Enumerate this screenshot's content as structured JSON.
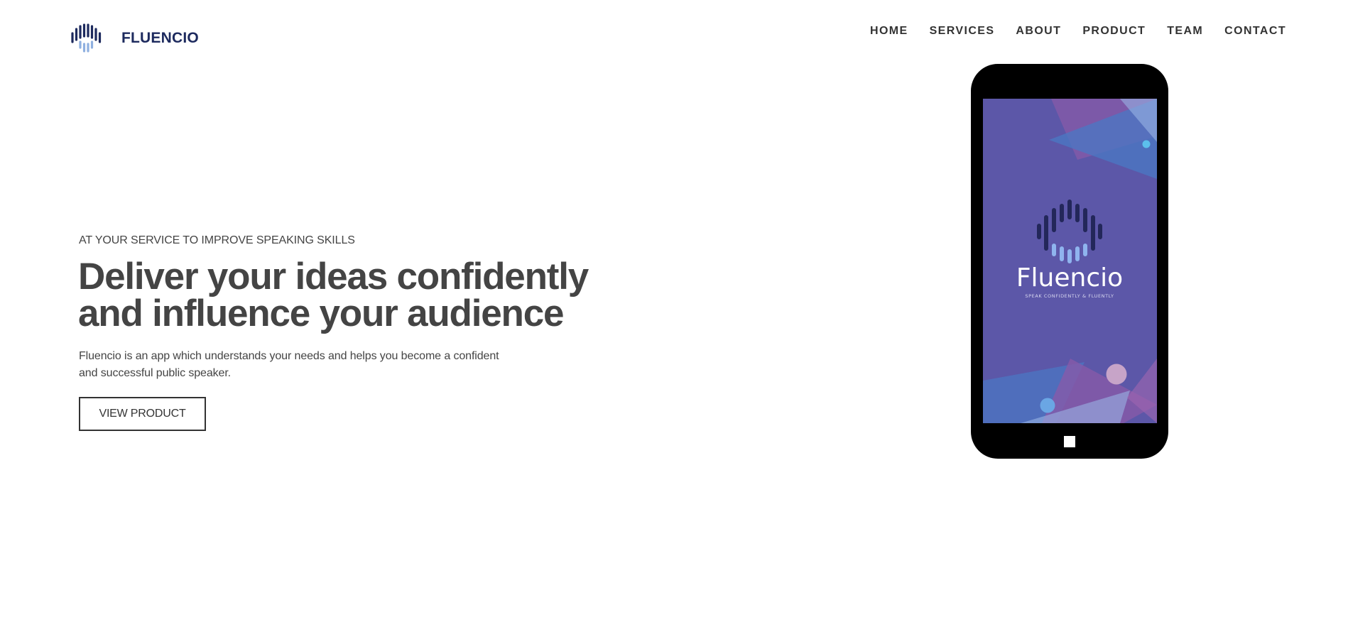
{
  "brand": {
    "name": "FLUENCIO",
    "logo_icon": "sound-wave-logo-icon"
  },
  "nav": {
    "items": [
      {
        "label": "HOME"
      },
      {
        "label": "SERVICES"
      },
      {
        "label": "ABOUT"
      },
      {
        "label": "PRODUCT"
      },
      {
        "label": "TEAM"
      },
      {
        "label": "CONTACT"
      }
    ]
  },
  "hero": {
    "eyebrow": "AT YOUR SERVICE TO IMPROVE SPEAKING SKILLS",
    "headline_line1": "Deliver your ideas confidently",
    "headline_line2": "and influence your audience",
    "lead_line1": "Fluencio is an app which understands your needs and helps you become a confident",
    "lead_line2": "and successful public speaker.",
    "cta_label": "VIEW PRODUCT"
  },
  "phone": {
    "app_name": "Fluencio",
    "tagline": "SPEAK CONFIDENTLY & FLUENTLY"
  },
  "colors": {
    "brand_navy": "#1d2a5e",
    "screen_purple": "#5c57a8",
    "text_gray": "#444444"
  }
}
